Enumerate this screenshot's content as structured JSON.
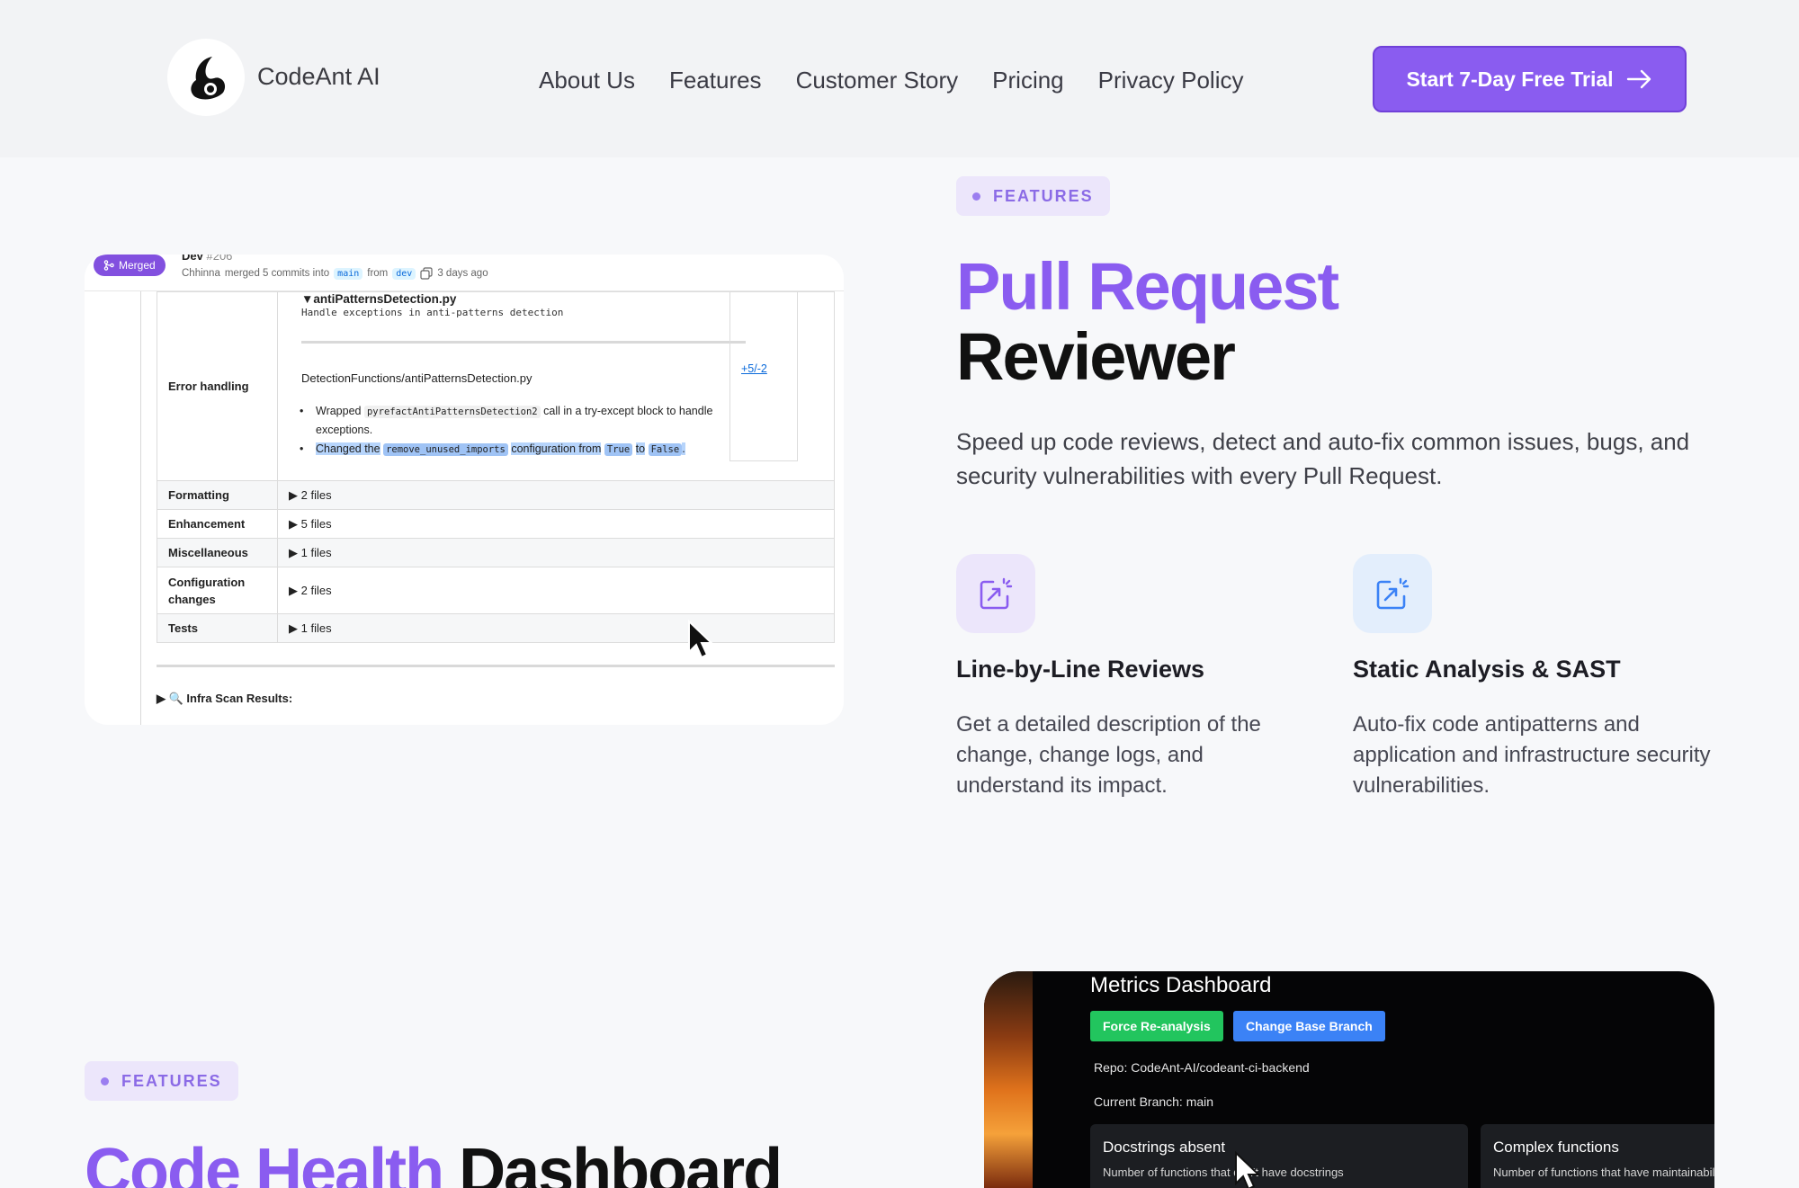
{
  "nav": {
    "brand": "CodeAnt AI",
    "links": [
      "About Us",
      "Features",
      "Customer Story",
      "Pricing",
      "Privacy Policy"
    ],
    "cta": "Start 7-Day Free Trial"
  },
  "pr_section": {
    "tag": "FEATURES",
    "title_colored": "Pull Request",
    "title_dark": "Reviewer",
    "lead": "Speed up code reviews, detect and auto-fix common issues, bugs, and security vulnerabilities with every Pull Request.",
    "features": [
      {
        "icon": "share-box-icon",
        "title": "Line-by-Line Reviews",
        "desc": "Get a detailed description of the change, change logs, and understand its impact."
      },
      {
        "icon": "share-box-icon",
        "title": "Static Analysis & SAST",
        "desc": "Auto-fix code antipatterns and application and infrastructure security vulnerabilities."
      }
    ],
    "pr_card": {
      "badge": "Merged",
      "title": "Dev",
      "number": "#206",
      "author": "Chhinna",
      "merged_text": "merged 5 commits into",
      "base": "main",
      "from_word": "from",
      "head": "dev",
      "ago": "3 days ago",
      "error_label": "Error handling",
      "file_name": "antiPatternsDetection.py",
      "file_note": "Handle exceptions in anti-patterns detection",
      "file_path": "DetectionFunctions/antiPatternsDetection.py",
      "bullet1_pre": "Wrapped",
      "bullet1_code": "pyrefactAntiPatternsDetection2",
      "bullet1_post": "call in a try-except block to handle exceptions.",
      "bullet2_pre": "Changed the",
      "bullet2_code": "remove_unused_imports",
      "bullet2_mid": "configuration from",
      "bullet2_code2": "True",
      "bullet2_to": "to",
      "bullet2_code3": "False",
      "bullet2_end": ".",
      "diff": "+5/-2",
      "rows": [
        {
          "label": "Formatting",
          "files": "▶ 2 files"
        },
        {
          "label": "Enhancement",
          "files": "▶ 5 files"
        },
        {
          "label": "Miscellaneous",
          "files": "▶ 1 files"
        },
        {
          "label": "Configuration changes",
          "files": "▶ 2 files"
        },
        {
          "label": "Tests",
          "files": "▶ 1 files"
        }
      ],
      "infra": "▶ 🔍 Infra Scan Results:"
    }
  },
  "dashboard_section": {
    "tag": "FEATURES",
    "title_colored": "Code Health",
    "title_dark": "Dashboard",
    "card": {
      "title": "Metrics Dashboard",
      "btn_reanalysis": "Force Re-analysis",
      "btn_branch": "Change Base Branch",
      "repo": "Repo: CodeAnt-AI/codeant-ci-backend",
      "branch": "Current Branch: main",
      "metrics": [
        {
          "title": "Docstrings absent",
          "desc": "Number of functions that don't have docstrings"
        },
        {
          "title": "Complex functions",
          "desc": "Number of functions that have maintainability"
        }
      ]
    }
  },
  "colors": {
    "accent": "#8a5cf0",
    "green": "#22c55e",
    "blue": "#3b82f6"
  }
}
